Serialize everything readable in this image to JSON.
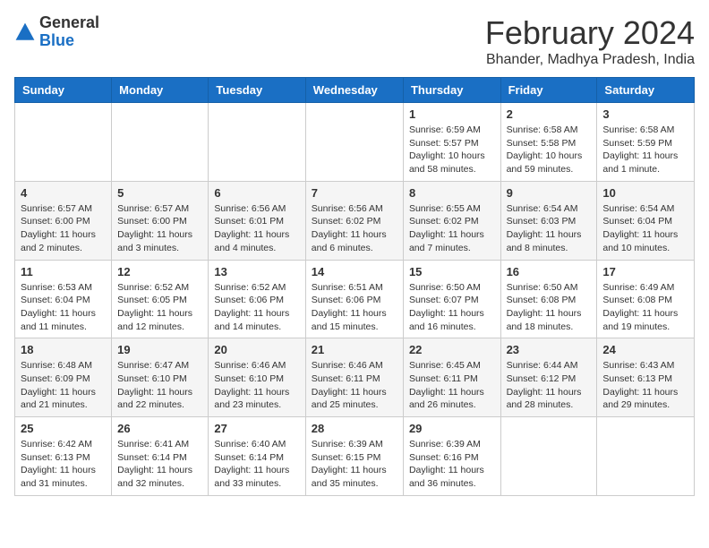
{
  "header": {
    "logo": {
      "general": "General",
      "blue": "Blue",
      "logo_shape": "triangle"
    },
    "title": "February 2024",
    "location": "Bhander, Madhya Pradesh, India"
  },
  "days_of_week": [
    "Sunday",
    "Monday",
    "Tuesday",
    "Wednesday",
    "Thursday",
    "Friday",
    "Saturday"
  ],
  "weeks": [
    [
      {
        "day": "",
        "info": ""
      },
      {
        "day": "",
        "info": ""
      },
      {
        "day": "",
        "info": ""
      },
      {
        "day": "",
        "info": ""
      },
      {
        "day": "1",
        "info": "Sunrise: 6:59 AM\nSunset: 5:57 PM\nDaylight: 10 hours\nand 58 minutes."
      },
      {
        "day": "2",
        "info": "Sunrise: 6:58 AM\nSunset: 5:58 PM\nDaylight: 10 hours\nand 59 minutes."
      },
      {
        "day": "3",
        "info": "Sunrise: 6:58 AM\nSunset: 5:59 PM\nDaylight: 11 hours\nand 1 minute."
      }
    ],
    [
      {
        "day": "4",
        "info": "Sunrise: 6:57 AM\nSunset: 6:00 PM\nDaylight: 11 hours\nand 2 minutes."
      },
      {
        "day": "5",
        "info": "Sunrise: 6:57 AM\nSunset: 6:00 PM\nDaylight: 11 hours\nand 3 minutes."
      },
      {
        "day": "6",
        "info": "Sunrise: 6:56 AM\nSunset: 6:01 PM\nDaylight: 11 hours\nand 4 minutes."
      },
      {
        "day": "7",
        "info": "Sunrise: 6:56 AM\nSunset: 6:02 PM\nDaylight: 11 hours\nand 6 minutes."
      },
      {
        "day": "8",
        "info": "Sunrise: 6:55 AM\nSunset: 6:02 PM\nDaylight: 11 hours\nand 7 minutes."
      },
      {
        "day": "9",
        "info": "Sunrise: 6:54 AM\nSunset: 6:03 PM\nDaylight: 11 hours\nand 8 minutes."
      },
      {
        "day": "10",
        "info": "Sunrise: 6:54 AM\nSunset: 6:04 PM\nDaylight: 11 hours\nand 10 minutes."
      }
    ],
    [
      {
        "day": "11",
        "info": "Sunrise: 6:53 AM\nSunset: 6:04 PM\nDaylight: 11 hours\nand 11 minutes."
      },
      {
        "day": "12",
        "info": "Sunrise: 6:52 AM\nSunset: 6:05 PM\nDaylight: 11 hours\nand 12 minutes."
      },
      {
        "day": "13",
        "info": "Sunrise: 6:52 AM\nSunset: 6:06 PM\nDaylight: 11 hours\nand 14 minutes."
      },
      {
        "day": "14",
        "info": "Sunrise: 6:51 AM\nSunset: 6:06 PM\nDaylight: 11 hours\nand 15 minutes."
      },
      {
        "day": "15",
        "info": "Sunrise: 6:50 AM\nSunset: 6:07 PM\nDaylight: 11 hours\nand 16 minutes."
      },
      {
        "day": "16",
        "info": "Sunrise: 6:50 AM\nSunset: 6:08 PM\nDaylight: 11 hours\nand 18 minutes."
      },
      {
        "day": "17",
        "info": "Sunrise: 6:49 AM\nSunset: 6:08 PM\nDaylight: 11 hours\nand 19 minutes."
      }
    ],
    [
      {
        "day": "18",
        "info": "Sunrise: 6:48 AM\nSunset: 6:09 PM\nDaylight: 11 hours\nand 21 minutes."
      },
      {
        "day": "19",
        "info": "Sunrise: 6:47 AM\nSunset: 6:10 PM\nDaylight: 11 hours\nand 22 minutes."
      },
      {
        "day": "20",
        "info": "Sunrise: 6:46 AM\nSunset: 6:10 PM\nDaylight: 11 hours\nand 23 minutes."
      },
      {
        "day": "21",
        "info": "Sunrise: 6:46 AM\nSunset: 6:11 PM\nDaylight: 11 hours\nand 25 minutes."
      },
      {
        "day": "22",
        "info": "Sunrise: 6:45 AM\nSunset: 6:11 PM\nDaylight: 11 hours\nand 26 minutes."
      },
      {
        "day": "23",
        "info": "Sunrise: 6:44 AM\nSunset: 6:12 PM\nDaylight: 11 hours\nand 28 minutes."
      },
      {
        "day": "24",
        "info": "Sunrise: 6:43 AM\nSunset: 6:13 PM\nDaylight: 11 hours\nand 29 minutes."
      }
    ],
    [
      {
        "day": "25",
        "info": "Sunrise: 6:42 AM\nSunset: 6:13 PM\nDaylight: 11 hours\nand 31 minutes."
      },
      {
        "day": "26",
        "info": "Sunrise: 6:41 AM\nSunset: 6:14 PM\nDaylight: 11 hours\nand 32 minutes."
      },
      {
        "day": "27",
        "info": "Sunrise: 6:40 AM\nSunset: 6:14 PM\nDaylight: 11 hours\nand 33 minutes."
      },
      {
        "day": "28",
        "info": "Sunrise: 6:39 AM\nSunset: 6:15 PM\nDaylight: 11 hours\nand 35 minutes."
      },
      {
        "day": "29",
        "info": "Sunrise: 6:39 AM\nSunset: 6:16 PM\nDaylight: 11 hours\nand 36 minutes."
      },
      {
        "day": "",
        "info": ""
      },
      {
        "day": "",
        "info": ""
      }
    ]
  ]
}
